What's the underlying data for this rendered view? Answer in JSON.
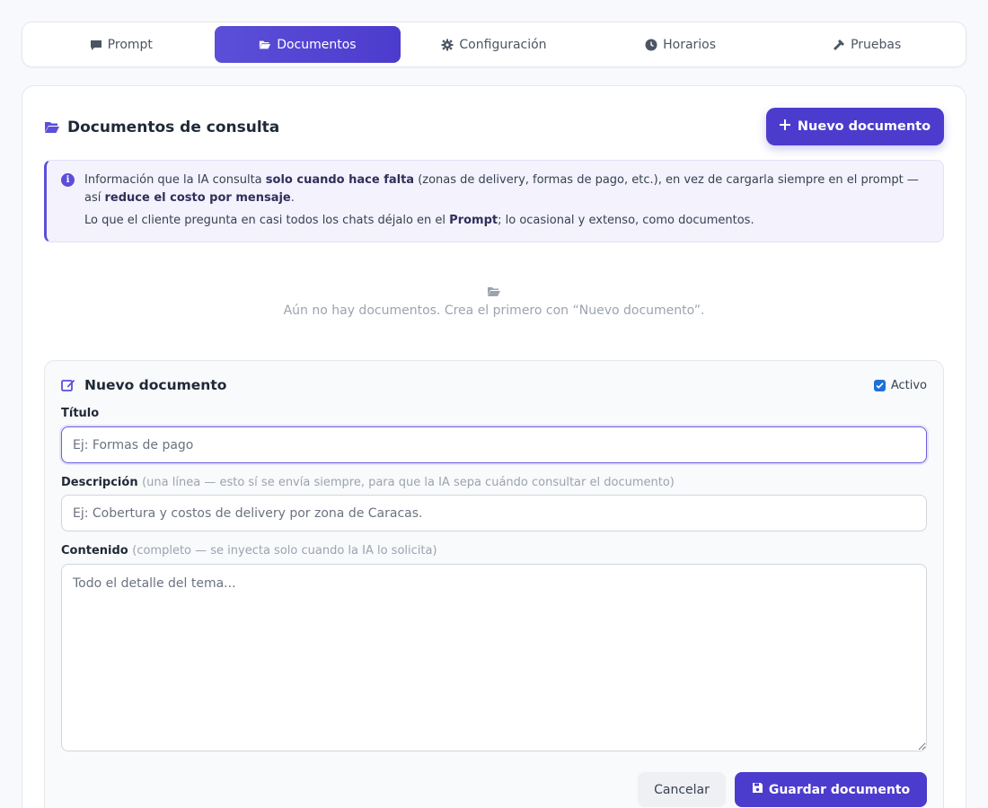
{
  "tabs": [
    {
      "label": "Prompt",
      "icon": "comment-icon",
      "active": false
    },
    {
      "label": "Documentos",
      "icon": "folder-open-icon",
      "active": true
    },
    {
      "label": "Configuración",
      "icon": "gear-icon",
      "active": false
    },
    {
      "label": "Horarios",
      "icon": "clock-icon",
      "active": false
    },
    {
      "label": "Pruebas",
      "icon": "hammer-icon",
      "active": false
    }
  ],
  "header": {
    "title": "Documentos de consulta",
    "new_button": "Nuevo documento"
  },
  "info": {
    "line1_a": "Información que la IA consulta ",
    "line1_b": "solo cuando hace falta",
    "line1_c": " (zonas de delivery, formas de pago, etc.), en vez de cargarla siempre en el prompt — así ",
    "line1_d": "reduce el costo por mensaje",
    "line1_e": ".",
    "line2_a": "Lo que el cliente pregunta en casi todos los chats déjalo en el ",
    "line2_b": "Prompt",
    "line2_c": "; lo ocasional y extenso, como documentos."
  },
  "empty_state": "Aún no hay documentos. Crea el primero con “Nuevo documento”.",
  "form": {
    "title": "Nuevo documento",
    "active_label": "Activo",
    "active_checked": true,
    "titulo_label": "Título",
    "titulo_placeholder": "Ej: Formas de pago",
    "descripcion_label": "Descripción",
    "descripcion_hint": "(una línea — esto sí se envía siempre, para que la IA sepa cuándo consultar el documento)",
    "descripcion_placeholder": "Ej: Cobertura y costos de delivery por zona de Caracas.",
    "contenido_label": "Contenido",
    "contenido_hint": "(completo — se inyecta solo cuando la IA lo solicita)",
    "contenido_placeholder": "Todo el detalle del tema...",
    "cancel_label": "Cancelar",
    "save_label": "Guardar documento"
  },
  "colors": {
    "accent": "#4c3ccd",
    "accent_light": "#5b4fd8",
    "info_bg": "#f3f2fd"
  }
}
